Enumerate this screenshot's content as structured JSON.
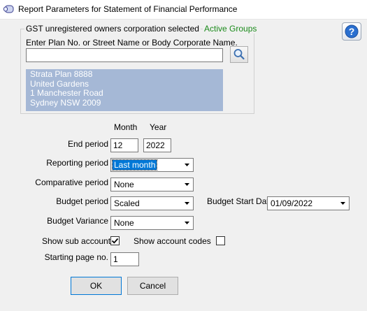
{
  "window": {
    "title": "Report Parameters for Statement of Financial Performance"
  },
  "group": {
    "legend": "GST unregistered owners corporation selected",
    "active_groups": "Active Groups",
    "search_label": "Enter Plan No. or Street Name or Body Corporate Name.",
    "search_value": "",
    "address_lines": [
      "Strata Plan 8888",
      "United Gardens",
      "1 Manchester Road",
      "Sydney  NSW  2009"
    ]
  },
  "columns": {
    "month": "Month",
    "year": "Year"
  },
  "end_period": {
    "label": "End period",
    "month": "12",
    "year": "2022"
  },
  "reporting_period": {
    "label": "Reporting period",
    "value": "Last month"
  },
  "comparative_period": {
    "label": "Comparative period",
    "value": "None"
  },
  "budget_period": {
    "label": "Budget period",
    "value": "Scaled"
  },
  "budget_start_date": {
    "label": "Budget Start Date",
    "value": "01/09/2022"
  },
  "budget_variance": {
    "label": "Budget Variance",
    "value": "None"
  },
  "show_sub_accounts": {
    "label": "Show sub accounts",
    "checked": true
  },
  "show_account_codes": {
    "label": "Show account codes",
    "checked": false
  },
  "starting_page": {
    "label": "Starting page no.",
    "value": "1"
  },
  "buttons": {
    "ok": "OK",
    "cancel": "Cancel"
  },
  "icons": {
    "app": "report-app-icon",
    "help": "help-icon",
    "search": "magnifier-icon",
    "dropdown": "chevron-down-icon",
    "check": "checkmark-icon"
  },
  "colors": {
    "address_bg": "#a5b8d6",
    "selection": "#0078d7",
    "active_groups": "#1a8a1a"
  }
}
